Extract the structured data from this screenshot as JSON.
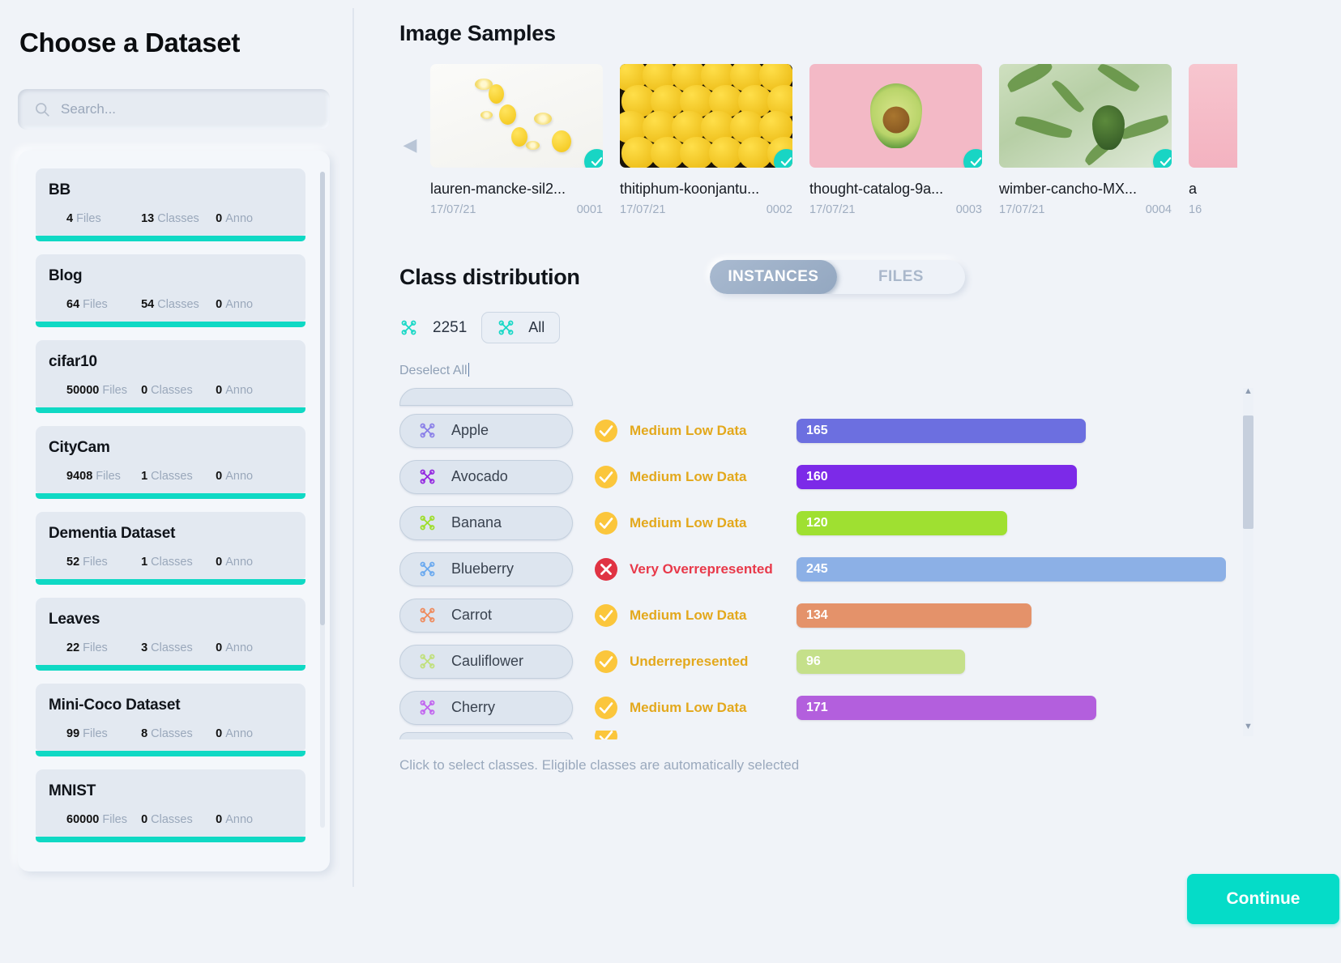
{
  "sidebar": {
    "title": "Choose a Dataset",
    "search": {
      "placeholder": "Search...",
      "value": "",
      "icon": "search-icon"
    },
    "datasets": [
      {
        "name": "BB",
        "files": "4",
        "files_label": "Files",
        "classes": "13",
        "classes_label": "Classes",
        "anno": "0",
        "anno_label": "Anno"
      },
      {
        "name": "Blog",
        "files": "64",
        "files_label": "Files",
        "classes": "54",
        "classes_label": "Classes",
        "anno": "0",
        "anno_label": "Anno"
      },
      {
        "name": "cifar10",
        "files": "50000",
        "files_label": "Files",
        "classes": "0",
        "classes_label": "Classes",
        "anno": "0",
        "anno_label": "Anno"
      },
      {
        "name": "CityCam",
        "files": "9408",
        "files_label": "Files",
        "classes": "1",
        "classes_label": "Classes",
        "anno": "0",
        "anno_label": "Anno"
      },
      {
        "name": "Dementia Dataset",
        "files": "52",
        "files_label": "Files",
        "classes": "1",
        "classes_label": "Classes",
        "anno": "0",
        "anno_label": "Anno"
      },
      {
        "name": "Leaves",
        "files": "22",
        "files_label": "Files",
        "classes": "3",
        "classes_label": "Classes",
        "anno": "0",
        "anno_label": "Anno"
      },
      {
        "name": "Mini-Coco Dataset",
        "files": "99",
        "files_label": "Files",
        "classes": "8",
        "classes_label": "Classes",
        "anno": "0",
        "anno_label": "Anno"
      },
      {
        "name": "MNIST",
        "files": "60000",
        "files_label": "Files",
        "classes": "0",
        "classes_label": "Classes",
        "anno": "0",
        "anno_label": "Anno"
      }
    ]
  },
  "samples": {
    "title": "Image Samples",
    "prev_icon": "chevron-left-icon",
    "next_icon": "chevron-right-icon",
    "items": [
      {
        "name": "lauren-mancke-sil2...",
        "date": "17/07/21",
        "index": "0001",
        "selected": true,
        "art": "lemons-white"
      },
      {
        "name": "thitiphum-koonjantu...",
        "date": "17/07/21",
        "index": "0002",
        "selected": true,
        "art": "lemons-pile"
      },
      {
        "name": "thought-catalog-9a...",
        "date": "17/07/21",
        "index": "0003",
        "selected": true,
        "art": "avocado-pink"
      },
      {
        "name": "wimber-cancho-MX...",
        "date": "17/07/21",
        "index": "0004",
        "selected": true,
        "art": "avocado-tree"
      },
      {
        "name": "a",
        "date": "16",
        "index": "",
        "selected": false,
        "art": "pink-partial"
      }
    ]
  },
  "distribution": {
    "title": "Class distribution",
    "tabs": [
      {
        "label": "INSTANCES",
        "active": true
      },
      {
        "label": "FILES",
        "active": false
      }
    ],
    "total_count": "2251",
    "total_icon": "graph-node-icon",
    "filter_chip": {
      "label": "All",
      "icon": "graph-node-icon"
    },
    "deselect_label": "Deselect All",
    "hint": "Click to select classes. Eligible classes are automatically selected",
    "scroll_up_icon": "triangle-up-icon",
    "scroll_down_icon": "triangle-down-icon"
  },
  "chart_data": {
    "type": "bar",
    "title": "Class distribution",
    "xlabel": "",
    "ylabel": "",
    "orientation": "horizontal",
    "xlim": [
      0,
      245
    ],
    "grid": false,
    "legend": false,
    "categories": [
      "Apple",
      "Avocado",
      "Banana",
      "Blueberry",
      "Carrot",
      "Cauliflower",
      "Cherry"
    ],
    "values": [
      165,
      160,
      120,
      245,
      134,
      96,
      171
    ],
    "colors": [
      "#6c6fe0",
      "#7c2ae8",
      "#9fe031",
      "#8cb0e6",
      "#e4926a",
      "#c5e08a",
      "#b35fdd"
    ],
    "status": [
      "Medium Low Data",
      "Medium Low Data",
      "Medium Low Data",
      "Very Overrepresented",
      "Medium Low Data",
      "Underrepresented",
      "Medium Low Data"
    ],
    "status_kind": [
      "ok",
      "ok",
      "ok",
      "bad",
      "ok",
      "ok",
      "ok"
    ],
    "chip_icon_colors": [
      "#8a7fe8",
      "#9327e0",
      "#9ede2a",
      "#6aa9ef",
      "#ef8a5c",
      "#c0e07b",
      "#c163ef"
    ],
    "total_instances": 2251
  },
  "footer": {
    "continue_label": "Continue"
  },
  "colors": {
    "accent": "#05dcc8",
    "background": "#f0f3f8",
    "status_ok": "#e3a81c",
    "status_bad": "#e8394a"
  }
}
